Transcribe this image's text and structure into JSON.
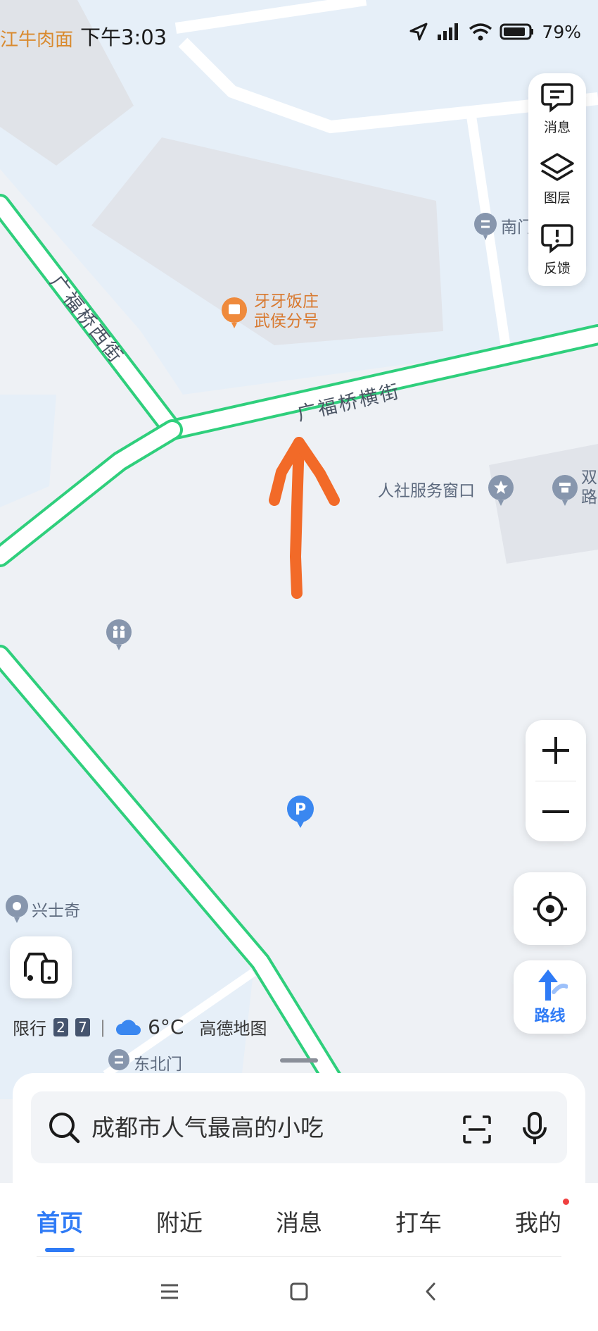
{
  "status_bar": {
    "left_label": "江牛肉面",
    "time": "下午3:03",
    "battery": "79%"
  },
  "map": {
    "streets": [
      "广福桥西街",
      "广福桥横街"
    ],
    "pois": [
      {
        "name": "牙牙饭庄",
        "sub": "武侯分号",
        "icon": "restaurant-icon",
        "color": "#ef8a3c"
      },
      {
        "name": "南门",
        "icon": "gate-icon"
      },
      {
        "name": "人社服务窗口",
        "icon": "star-icon"
      },
      {
        "name": "双",
        "sub": "路",
        "icon": "police-icon"
      },
      {
        "name": "兴士奇",
        "icon": "place-icon"
      },
      {
        "name": "东北门",
        "icon": "gate-icon"
      }
    ],
    "parking_icon": "parking-icon",
    "restroom_icon": "restroom-icon",
    "annotation": "orange-arrow"
  },
  "side_panel": {
    "messages": "消息",
    "layers": "图层",
    "feedback": "反馈"
  },
  "controls": {
    "route": "路线"
  },
  "info_bar": {
    "restriction_label": "限行",
    "plate_1": "2",
    "plate_2": "7",
    "separator": "|",
    "temperature": "6°C",
    "brand": "高德地图"
  },
  "search": {
    "placeholder": "成都市人气最高的小吃"
  },
  "tabs": [
    {
      "label": "首页",
      "active": true
    },
    {
      "label": "附近"
    },
    {
      "label": "消息"
    },
    {
      "label": "打车"
    },
    {
      "label": "我的",
      "badge": true
    }
  ],
  "colors": {
    "accent": "#2f7bf6",
    "road_outline": "#2fcf7c",
    "annotation": "#f26a28"
  }
}
